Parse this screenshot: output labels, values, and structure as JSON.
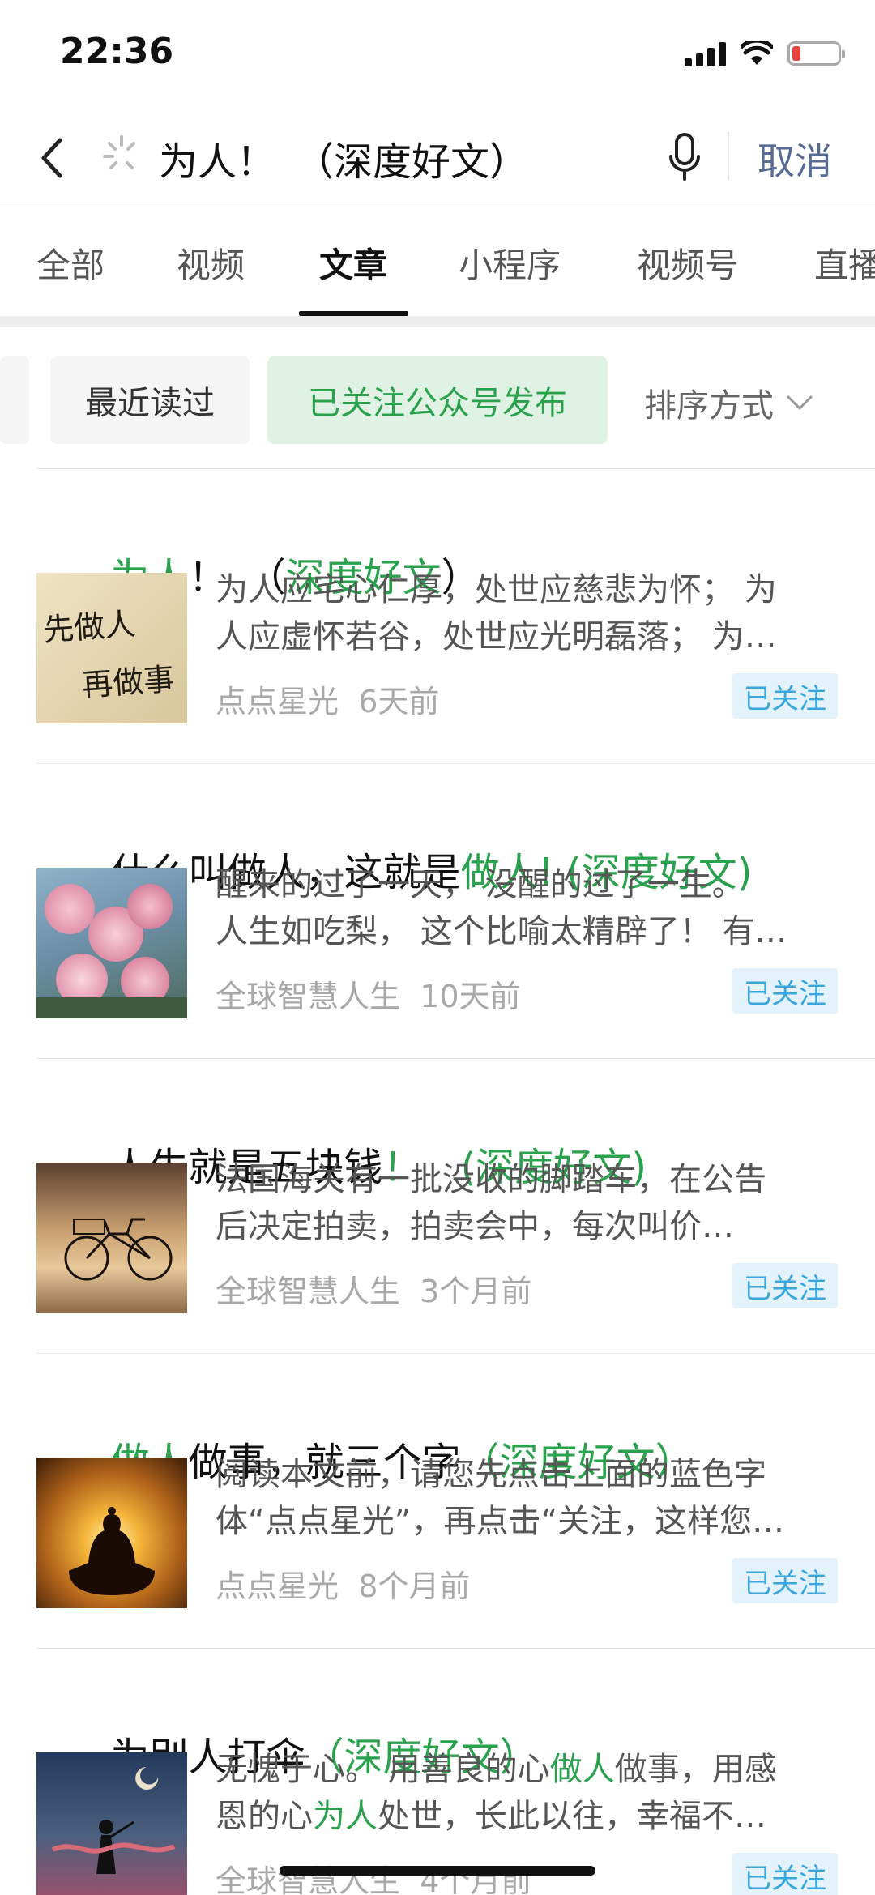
{
  "status_bar": {
    "time": "22:36"
  },
  "search": {
    "query": "为人！　（深度好文）",
    "cancel_label": "取消"
  },
  "tabs": [
    {
      "label": "全部"
    },
    {
      "label": "视频"
    },
    {
      "label": "文章"
    },
    {
      "label": "小程序"
    },
    {
      "label": "视频号"
    },
    {
      "label": "直播"
    }
  ],
  "active_tab": "文章",
  "filters": {
    "recent": "最近读过",
    "followed": "已关注公众号发布",
    "sort": "排序方式"
  },
  "results": [
    {
      "title_parts": [
        {
          "text": "为人",
          "hl": true
        },
        {
          "text": "！　（",
          "hl": false
        },
        {
          "text": "深度好文",
          "hl": true
        },
        {
          "text": "）",
          "hl": false
        }
      ],
      "snippet_line1": "为人应宅心仁厚，处世应慈悲为怀； 为",
      "snippet_line2": "人应虚怀若谷，处世应光明磊落； 为…",
      "source": "点点星光",
      "time": "6天前",
      "badge": "已关注",
      "thumb_text1": "先做人",
      "thumb_text2": "再做事"
    },
    {
      "title_parts": [
        {
          "text": "什么叫做人，这就是",
          "hl": false
        },
        {
          "text": "做人! (深度好文)",
          "hl": true
        }
      ],
      "snippet_line1": "醒来的过了一天， 没醒的过了一生。",
      "snippet_line2": "人生如吃梨， 这个比喻太精辟了！ 有…",
      "source": "全球智慧人生",
      "time": "10天前",
      "badge": "已关注"
    },
    {
      "title_parts": [
        {
          "text": "人生就是五块钱",
          "hl": false
        },
        {
          "text": "！　(深度好文)",
          "hl": true
        }
      ],
      "snippet_line1": "法国海关有一批没收的脚踏车，在公告",
      "snippet_line2": "后决定拍卖，拍卖会中，每次叫价…",
      "source": "全球智慧人生",
      "time": "3个月前",
      "badge": "已关注"
    },
    {
      "title_parts": [
        {
          "text": "做人",
          "hl": true
        },
        {
          "text": "做事，就三个字",
          "hl": false
        },
        {
          "text": "（深度好文）",
          "hl": true
        }
      ],
      "snippet_line1": "阅读本文前，请您先点击上面的蓝色字",
      "snippet_line2": "体“点点星光”，再点击“关注，这样您…",
      "source": "点点星光",
      "time": "8个月前",
      "badge": "已关注"
    },
    {
      "title_parts": [
        {
          "text": "为别人打伞",
          "hl": false
        },
        {
          "text": "（深度好文）",
          "hl": true
        }
      ],
      "snippet_parts1": [
        {
          "text": "无愧于心。 用善良的心",
          "hl": false
        },
        {
          "text": "做人",
          "hl": true
        },
        {
          "text": "做事，用感",
          "hl": false
        }
      ],
      "snippet_parts2": [
        {
          "text": "恩的心",
          "hl": false
        },
        {
          "text": "为人",
          "hl": true
        },
        {
          "text": "处世，长此以往，幸福不…",
          "hl": false
        }
      ],
      "source": "全球智慧人生",
      "time": "4个月前",
      "badge": "已关注"
    }
  ],
  "colors": {
    "highlight": "#2aa14c",
    "link": "#576b95",
    "badge_text": "#3aa6dc",
    "badge_bg": "#e4f3fb"
  }
}
